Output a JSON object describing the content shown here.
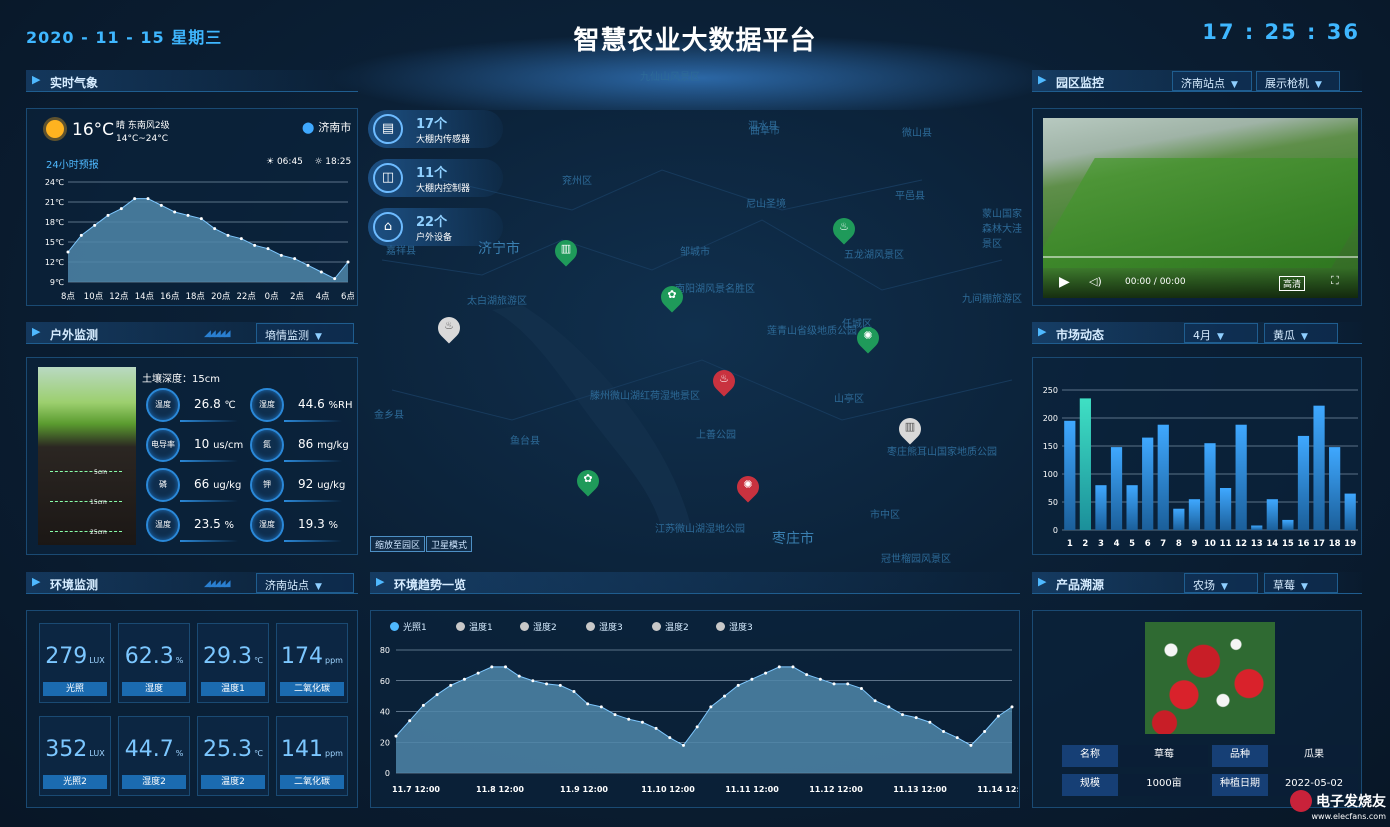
{
  "header": {
    "date": "2020 - 11 - 15   星期三",
    "title": "智慧农业大数据平台",
    "time": "17 : 25 : 36"
  },
  "weather": {
    "panel_title": "实时气象",
    "temp": "16°C",
    "desc": "晴 东南风2级",
    "range": "14°C~24°C",
    "city": "济南市",
    "forecast_label": "24小时预报",
    "sunrise": "06:45",
    "sunset": "18:25",
    "icon": "sun-icon",
    "chart_data": {
      "type": "area",
      "title": "",
      "categories": [
        "8点",
        "10点",
        "12点",
        "14点",
        "16点",
        "18点",
        "20点",
        "22点",
        "0点",
        "2点",
        "4点",
        "6点"
      ],
      "y_ticks": [
        "24℃",
        "21℃",
        "18℃",
        "15℃",
        "12℃",
        "9℃"
      ],
      "ylim": [
        9,
        24
      ],
      "values": [
        13.5,
        16,
        17.5,
        19,
        20,
        21.5,
        21.5,
        20.5,
        19.5,
        19,
        18.5,
        17,
        16,
        15.5,
        14.5,
        14,
        13,
        12.5,
        11.5,
        10.5,
        9.5,
        12
      ]
    }
  },
  "outdoor": {
    "panel_title": "户外监测",
    "select": "墒情监测",
    "depth_label": "土壤深度：15cm",
    "soil_lines": [
      "5cm",
      "15cm",
      "25cm"
    ],
    "sensors": [
      {
        "label": "温度",
        "value": "26.8",
        "unit": "℃"
      },
      {
        "label": "湿度",
        "value": "44.6",
        "unit": "%RH"
      },
      {
        "label": "电导率",
        "value": "10",
        "unit": "us/cm"
      },
      {
        "label": "氮",
        "value": "86",
        "unit": "mg/kg"
      },
      {
        "label": "磷",
        "value": "66",
        "unit": "ug/kg"
      },
      {
        "label": "钾",
        "value": "92",
        "unit": "ug/kg"
      },
      {
        "label": "温度",
        "value": "23.5",
        "unit": "%"
      },
      {
        "label": "湿度",
        "value": "19.3",
        "unit": "%"
      }
    ]
  },
  "env": {
    "panel_title": "环境监测",
    "select": "济南站点",
    "cards": [
      {
        "value": "279",
        "unit": "LUX",
        "label": "光照"
      },
      {
        "value": "62.3",
        "unit": "%",
        "label": "湿度"
      },
      {
        "value": "29.3",
        "unit": "℃",
        "label": "温度1"
      },
      {
        "value": "174",
        "unit": "ppm",
        "label": "二氧化碳"
      },
      {
        "value": "352",
        "unit": "LUX",
        "label": "光照2"
      },
      {
        "value": "44.7",
        "unit": "%",
        "label": "湿度2"
      },
      {
        "value": "25.3",
        "unit": "℃",
        "label": "温度2"
      },
      {
        "value": "141",
        "unit": "ppm",
        "label": "二氧化碳"
      }
    ]
  },
  "map": {
    "stats": [
      {
        "num": "17个",
        "label": "大棚内传感器",
        "icon": "sensor-icon"
      },
      {
        "num": "11个",
        "label": "大棚内控制器",
        "icon": "controller-icon"
      },
      {
        "num": "22个",
        "label": "户外设备",
        "icon": "outdoor-device-icon"
      }
    ],
    "place_names": [
      "济宁市",
      "太白湖旅游区",
      "南阳湖风景名胜区",
      "尼山圣境",
      "五龙湖风景区",
      "莲青山省级地质公园",
      "滕州微山湖红荷湿地景区",
      "上善公园",
      "枣庄熊耳山国家地质公园",
      "江苏微山湖湿地公园",
      "枣庄市",
      "冠世榴园风景区",
      "九仙山风景区",
      "九间棚旅游区",
      "蒙山国家森林大洼景区",
      "兖州区",
      "平邑县",
      "山亭区",
      "市中区",
      "鱼台县",
      "金乡县",
      "嘉祥县",
      "邹城市",
      "任城区",
      "曲阜市",
      "微山县",
      "泗水县"
    ],
    "btn_zoom": "缩放至园区",
    "btn_satellite": "卫星模式"
  },
  "trend": {
    "panel_title": "环境趋势一览",
    "legend": [
      "光照1",
      "温度1",
      "湿度2",
      "湿度3",
      "温度2",
      "湿度3"
    ],
    "chart_data": {
      "type": "area",
      "title": "",
      "x_ticks": [
        "11.7 12:00",
        "11.8 12:00",
        "11.9 12:00",
        "11.10 12:00",
        "11.11 12:00",
        "11.12 12:00",
        "11.13 12:00",
        "11.14 12:00"
      ],
      "y_ticks": [
        "80",
        "60",
        "40",
        "20",
        "0"
      ],
      "ylim": [
        0,
        80
      ],
      "series": [
        {
          "name": "光照1",
          "values": [
            24,
            34,
            44,
            51,
            57,
            61,
            65,
            69,
            69,
            63,
            60,
            58,
            57,
            53,
            45,
            43,
            38,
            35,
            33,
            29,
            23,
            18,
            30,
            43,
            50,
            57,
            61,
            65,
            69,
            69,
            64,
            61,
            58,
            58,
            55,
            47,
            43,
            38,
            36,
            33,
            27,
            23,
            18,
            27,
            37,
            43
          ]
        }
      ]
    }
  },
  "camera": {
    "panel_title": "园区监控",
    "select1": "济南站点",
    "select2": "展示枪机",
    "time_text": "00:00 / 00:00",
    "badge": "高清"
  },
  "market": {
    "panel_title": "市场动态",
    "select1": "4月",
    "select2": "黄瓜",
    "chart_data": {
      "type": "bar",
      "title": "",
      "categories": [
        "1",
        "2",
        "3",
        "4",
        "5",
        "6",
        "7",
        "8",
        "9",
        "10",
        "11",
        "12",
        "13",
        "14",
        "15",
        "16",
        "17",
        "18",
        "19"
      ],
      "values": [
        195,
        235,
        80,
        148,
        80,
        165,
        188,
        38,
        55,
        155,
        75,
        188,
        8,
        55,
        18,
        168,
        222,
        148,
        65
      ],
      "highlight_index": 1,
      "y_ticks": [
        "250",
        "200",
        "150",
        "100",
        "50",
        "0"
      ],
      "ylim": [
        0,
        250
      ]
    }
  },
  "product": {
    "panel_title": "产品溯源",
    "select1": "农场",
    "select2": "草莓",
    "table": [
      {
        "k": "名称",
        "v": "草莓"
      },
      {
        "k": "品种",
        "v": "瓜果"
      },
      {
        "k": "规模",
        "v": "1000亩"
      },
      {
        "k": "种植日期",
        "v": "2022-05-02"
      }
    ]
  },
  "brand": {
    "name": "电子发烧友",
    "site": "www.elecfans.com"
  }
}
